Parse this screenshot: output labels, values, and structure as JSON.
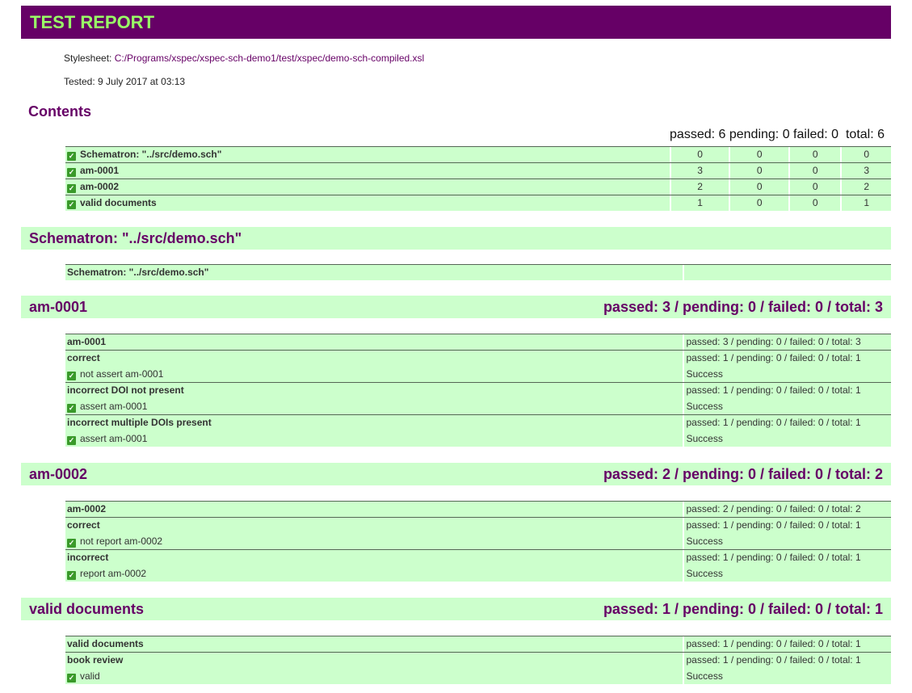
{
  "header": {
    "title": "TEST REPORT",
    "stylesheet_label": "Stylesheet: ",
    "stylesheet_path": "C:/Programs/xspec/xspec-sch-demo1/test/xspec/demo-sch-compiled.xsl",
    "tested": "Tested: 9 July 2017 at 03:13"
  },
  "contents": {
    "heading": "Contents",
    "summary": "passed: 6 pending: 0 failed: 0  total: 6",
    "rows": [
      {
        "label": "Schematron: \"../src/demo.sch\"",
        "passed": "0",
        "pending": "0",
        "failed": "0",
        "total": "0"
      },
      {
        "label": "am-0001",
        "passed": "3",
        "pending": "0",
        "failed": "0",
        "total": "3"
      },
      {
        "label": "am-0002",
        "passed": "2",
        "pending": "0",
        "failed": "0",
        "total": "2"
      },
      {
        "label": "valid documents",
        "passed": "1",
        "pending": "0",
        "failed": "0",
        "total": "1"
      }
    ]
  },
  "sections": {
    "schematron": {
      "title": "Schematron: \"../src/demo.sch\"",
      "row_label": "Schematron: \"../src/demo.sch\""
    },
    "am0001": {
      "title": "am-0001",
      "summary": "passed: 3 / pending: 0 / failed: 0 / total: 3",
      "rows": [
        {
          "label": "am-0001",
          "result": "passed: 3 / pending: 0 / failed: 0 / total: 3"
        },
        {
          "label": "correct",
          "result": "passed: 1 / pending: 0 / failed: 0 / total: 1"
        },
        {
          "label": "not assert am-0001",
          "result": "Success"
        },
        {
          "label": "incorrect DOI not present",
          "result": "passed: 1 / pending: 0 / failed: 0 / total: 1"
        },
        {
          "label": "assert am-0001",
          "result": "Success"
        },
        {
          "label": "incorrect multiple DOIs present",
          "result": "passed: 1 / pending: 0 / failed: 0 / total: 1"
        },
        {
          "label": "assert am-0001",
          "result": "Success"
        }
      ]
    },
    "am0002": {
      "title": "am-0002",
      "summary": "passed: 2 / pending: 0 / failed: 0 / total: 2",
      "rows": [
        {
          "label": "am-0002",
          "result": "passed: 2 / pending: 0 / failed: 0 / total: 2"
        },
        {
          "label": "correct",
          "result": "passed: 1 / pending: 0 / failed: 0 / total: 1"
        },
        {
          "label": "not report am-0002",
          "result": "Success"
        },
        {
          "label": "incorrect",
          "result": "passed: 1 / pending: 0 / failed: 0 / total: 1"
        },
        {
          "label": "report am-0002",
          "result": "Success"
        }
      ]
    },
    "valid": {
      "title": "valid documents",
      "summary": "passed: 1 / pending: 0 / failed: 0 / total: 1",
      "rows": [
        {
          "label": "valid documents",
          "result": "passed: 1 / pending: 0 / failed: 0 / total: 1"
        },
        {
          "label": "book review",
          "result": "passed: 1 / pending: 0 / failed: 0 / total: 1"
        },
        {
          "label": "valid",
          "result": "Success"
        }
      ]
    }
  },
  "colors": {
    "purple": "#660066",
    "title_green": "#99ff66",
    "pale_green": "#ccffcc",
    "check_green": "#3a9a2a"
  },
  "icons": {
    "check": "check-box-icon"
  }
}
